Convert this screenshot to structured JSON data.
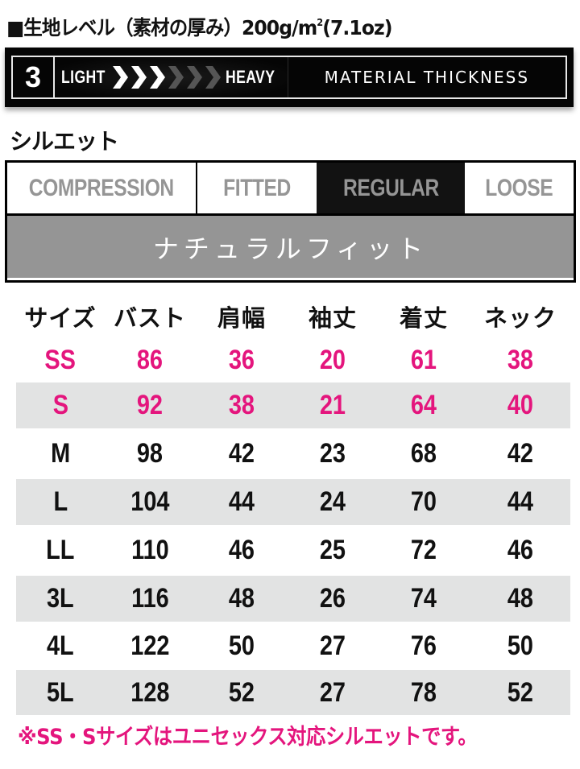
{
  "header": {
    "title_prefix": "■生地レベル（素材の厚み）200g/m",
    "title_sup": "2",
    "title_suffix": "(7.1oz)"
  },
  "thickness": {
    "level": "3",
    "light_label": "LIGHT",
    "heavy_label": "HEAVY",
    "caption": "MATERIAL THICKNESS",
    "total_steps": 6,
    "active_steps": 3,
    "active_color": "#ffffff",
    "inactive_color": "#555555"
  },
  "silhouette": {
    "title": "シルエット",
    "options": [
      {
        "label": "COMPRESSION",
        "selected": false
      },
      {
        "label": "FITTED",
        "selected": false
      },
      {
        "label": "REGULAR",
        "selected": true
      },
      {
        "label": "LOOSE",
        "selected": false
      }
    ],
    "description": "ナチュラルフィット"
  },
  "size_table": {
    "headers": [
      "サイズ",
      "バスト",
      "肩幅",
      "袖丈",
      "着丈",
      "ネック"
    ],
    "rows": [
      {
        "cells": [
          "SS",
          "86",
          "36",
          "20",
          "61",
          "38"
        ],
        "highlight": true
      },
      {
        "cells": [
          "S",
          "92",
          "38",
          "21",
          "64",
          "40"
        ],
        "highlight": true
      },
      {
        "cells": [
          "M",
          "98",
          "42",
          "23",
          "68",
          "42"
        ],
        "highlight": false
      },
      {
        "cells": [
          "L",
          "104",
          "44",
          "24",
          "70",
          "44"
        ],
        "highlight": false
      },
      {
        "cells": [
          "LL",
          "110",
          "46",
          "25",
          "72",
          "46"
        ],
        "highlight": false
      },
      {
        "cells": [
          "3L",
          "116",
          "48",
          "26",
          "74",
          "48"
        ],
        "highlight": false
      },
      {
        "cells": [
          "4L",
          "122",
          "50",
          "27",
          "76",
          "50"
        ],
        "highlight": false
      },
      {
        "cells": [
          "5L",
          "128",
          "52",
          "27",
          "78",
          "52"
        ],
        "highlight": false
      }
    ]
  },
  "note": "※SS・Sサイズはユニセックス対応シルエットです。",
  "colors": {
    "accent_pink": "#e4157d",
    "stripe_grey": "#e2e3e3",
    "fit_grey": "#959595",
    "selected_bg": "#121212"
  }
}
